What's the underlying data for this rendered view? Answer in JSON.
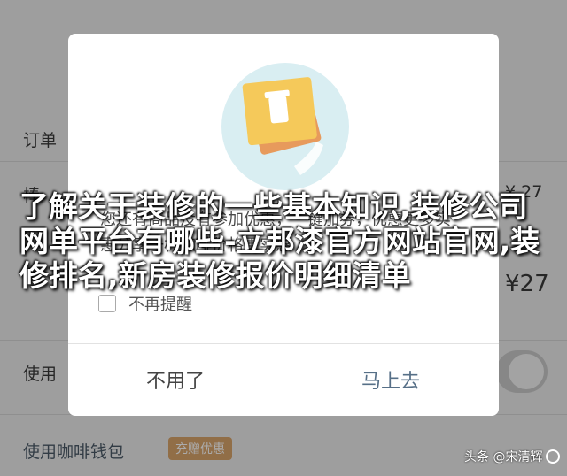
{
  "background": {
    "order_label": "订单",
    "cup_label": "棒",
    "price_1": "¥ 27",
    "price_2": "¥27",
    "use_label": "使用",
    "wallet_label": "使用咖啡钱包",
    "wallet_badge": "充赠优惠"
  },
  "dialog": {
    "message": "您还有商品没有参加优惠，一键加券，优惠更多实惠分享一杯咖啡价格更实惠",
    "checkbox_label": "不再提醒",
    "cancel_label": "不用了",
    "confirm_label": "马上去"
  },
  "overlay": {
    "title": "了解关于装修的一些基本知识,装修公司网单平台有哪些-立邦漆官方网站官网,装修排名,新房装修报价明细清单"
  },
  "watermark": {
    "text": "头条 @宋清辉"
  },
  "colors": {
    "confirm_text": "#566f87",
    "illustration_circle": "#d9eef2",
    "card_front": "#f5c95a",
    "card_back": "#e79a5c",
    "badge": "#d9a46b"
  }
}
